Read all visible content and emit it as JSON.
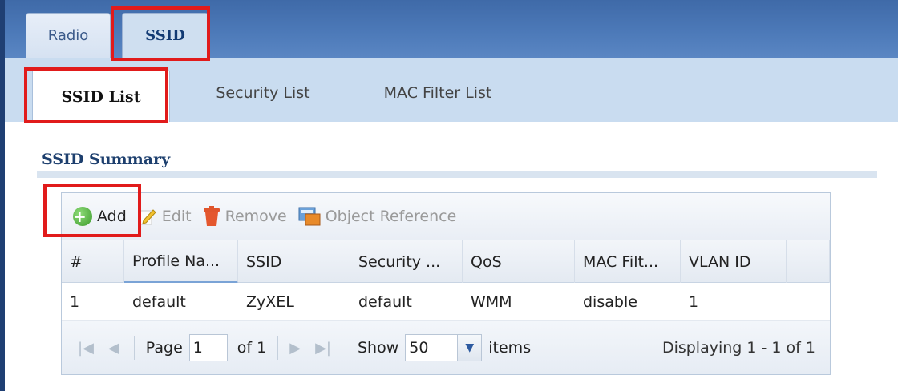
{
  "tabs": {
    "top": [
      "Radio",
      "SSID"
    ],
    "sub": [
      "SSID List",
      "Security List",
      "MAC Filter List"
    ]
  },
  "section": {
    "title": "SSID Summary"
  },
  "toolbar": {
    "add": "Add",
    "edit": "Edit",
    "remove": "Remove",
    "object_reference": "Object Reference"
  },
  "table": {
    "headers": [
      "#",
      "Profile Na...",
      "SSID",
      "Security ...",
      "QoS",
      "MAC Filt...",
      "VLAN ID"
    ],
    "rows": [
      [
        "1",
        "default",
        "ZyXEL",
        "default",
        "WMM",
        "disable",
        "1"
      ]
    ]
  },
  "pager": {
    "page_label": "Page",
    "page_value": "1",
    "of_label": "of 1",
    "show_label": "Show",
    "show_value": "50",
    "items_label": "items",
    "display_text": "Displaying 1 - 1 of 1"
  },
  "colors": {
    "highlight": "#e11b1b",
    "header_blue": "#4c79b8",
    "subtab_bg": "#c9dcf0"
  }
}
